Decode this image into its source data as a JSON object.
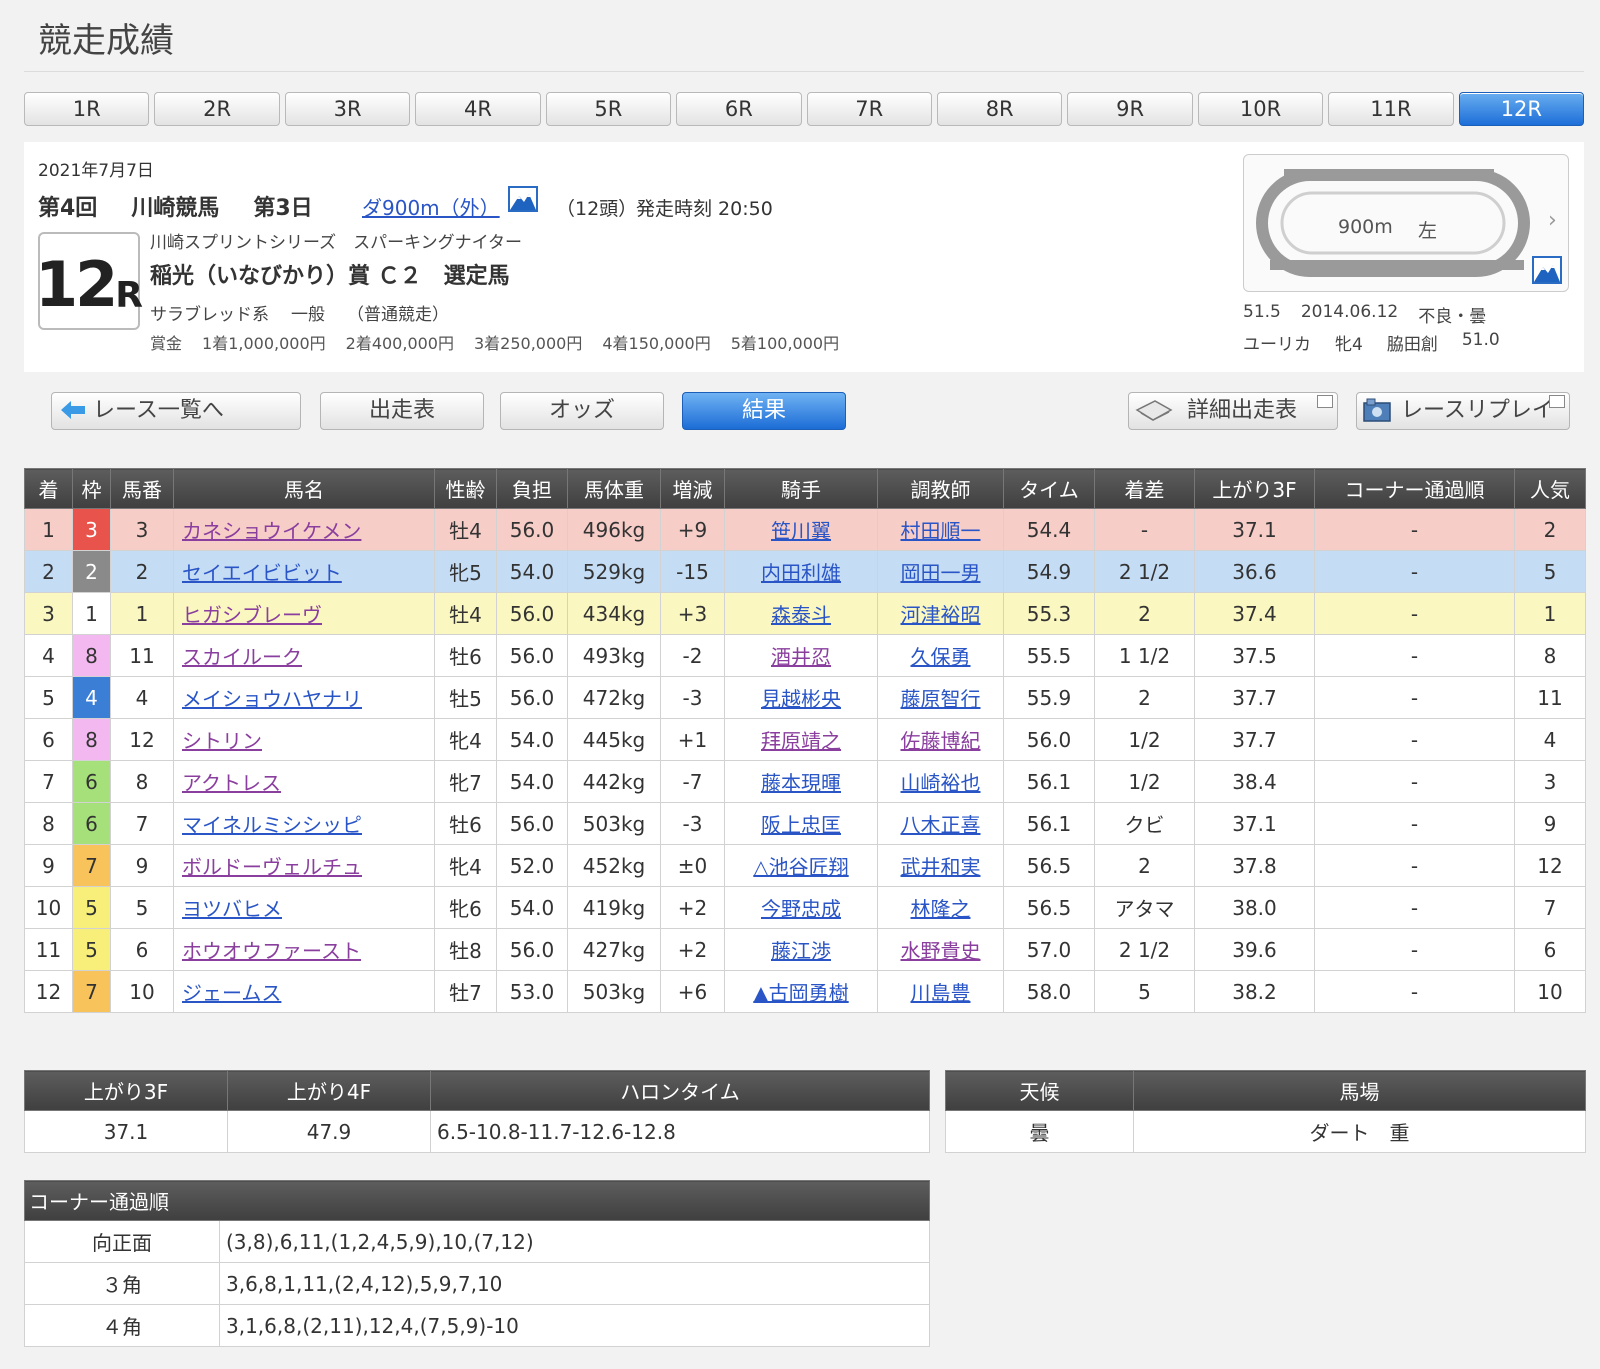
{
  "page": {
    "title": "競走成績"
  },
  "race_tabs": [
    "1R",
    "2R",
    "3R",
    "4R",
    "5R",
    "6R",
    "7R",
    "8R",
    "9R",
    "10R",
    "11R",
    "12R"
  ],
  "active_tab": "12R",
  "race_info": {
    "date": "2021年7月7日",
    "meeting": "第4回",
    "venue": "川崎競馬",
    "day": "第3日",
    "distance": "ダ900m（外）",
    "heads": "（12頭）",
    "post_time": "発走時刻 20:50",
    "race_number": "12",
    "race_number_suffix": "R",
    "series": "川崎スプリントシリーズ　スパーキングナイター",
    "race_name": "稲光（いなびかり）賞 Ｃ２　選定馬",
    "breed": "サラブレッド系",
    "class": "一般",
    "race_type": "（普通競走）",
    "prize_label": "賞金",
    "prizes": [
      "1着1,000,000円",
      "2着400,000円",
      "3着250,000円",
      "4着150,000円",
      "5着100,000円"
    ]
  },
  "course": {
    "distance": "900m",
    "direction": "左",
    "chevron": "›",
    "record_time": "51.5",
    "record_date": "2014.06.12",
    "record_condition": "不良・曇",
    "record_horse": "ユーリカ",
    "record_sex_age": "牝4",
    "record_jockey": "脇田創",
    "record_weight": "51.0"
  },
  "nav": {
    "race_list": "レース一覧へ",
    "entries": "出走表",
    "odds": "オッズ",
    "result": "結果",
    "detail_entries": "詳細出走表",
    "replay": "レースリプレイ"
  },
  "results": {
    "headers": [
      "着",
      "枠",
      "馬番",
      "馬名",
      "性齢",
      "負担",
      "馬体重",
      "増減",
      "騎手",
      "調教師",
      "タイム",
      "着差",
      "上がり3F",
      "コーナー通過順",
      "人気"
    ],
    "rows": [
      {
        "place": "1",
        "waku": "3",
        "num": "3",
        "horse": "カネショウイケメン",
        "horse_link": "purple",
        "sexage": "牡4",
        "burden": "56.0",
        "weight": "496kg",
        "diff": "+9",
        "jockey": "笹川翼",
        "jockey_link": "blue",
        "trainer": "村田順一",
        "trainer_link": "blue",
        "time": "54.4",
        "margin": "-",
        "last3f": "37.1",
        "corner": "-",
        "pop": "2"
      },
      {
        "place": "2",
        "waku": "2",
        "num": "2",
        "horse": "セイエイビビット",
        "horse_link": "blue",
        "sexage": "牝5",
        "burden": "54.0",
        "weight": "529kg",
        "diff": "-15",
        "jockey": "内田利雄",
        "jockey_link": "blue",
        "trainer": "岡田一男",
        "trainer_link": "blue",
        "time": "54.9",
        "margin": "2 1/2",
        "last3f": "36.6",
        "corner": "-",
        "pop": "5"
      },
      {
        "place": "3",
        "waku": "1",
        "num": "1",
        "horse": "ヒガシブレーヴ",
        "horse_link": "purple",
        "sexage": "牡4",
        "burden": "56.0",
        "weight": "434kg",
        "diff": "+3",
        "jockey": "森泰斗",
        "jockey_link": "blue",
        "trainer": "河津裕昭",
        "trainer_link": "blue",
        "time": "55.3",
        "margin": "2",
        "last3f": "37.4",
        "corner": "-",
        "pop": "1"
      },
      {
        "place": "4",
        "waku": "8",
        "num": "11",
        "horse": "スカイルーク",
        "horse_link": "purple",
        "sexage": "牡6",
        "burden": "56.0",
        "weight": "493kg",
        "diff": "-2",
        "jockey": "酒井忍",
        "jockey_link": "purple",
        "trainer": "久保勇",
        "trainer_link": "blue",
        "time": "55.5",
        "margin": "1 1/2",
        "last3f": "37.5",
        "corner": "-",
        "pop": "8"
      },
      {
        "place": "5",
        "waku": "4",
        "num": "4",
        "horse": "メイショウハヤナリ",
        "horse_link": "blue",
        "sexage": "牡5",
        "burden": "56.0",
        "weight": "472kg",
        "diff": "-3",
        "jockey": "見越彬央",
        "jockey_link": "blue",
        "trainer": "藤原智行",
        "trainer_link": "blue",
        "time": "55.9",
        "margin": "2",
        "last3f": "37.7",
        "corner": "-",
        "pop": "11"
      },
      {
        "place": "6",
        "waku": "8",
        "num": "12",
        "horse": "シトリン",
        "horse_link": "purple",
        "sexage": "牝4",
        "burden": "54.0",
        "weight": "445kg",
        "diff": "+1",
        "jockey": "拜原靖之",
        "jockey_link": "purple",
        "trainer": "佐藤博紀",
        "trainer_link": "purple",
        "time": "56.0",
        "margin": "1/2",
        "last3f": "37.7",
        "corner": "-",
        "pop": "4"
      },
      {
        "place": "7",
        "waku": "6",
        "num": "8",
        "horse": "アクトレス",
        "horse_link": "purple",
        "sexage": "牝7",
        "burden": "54.0",
        "weight": "442kg",
        "diff": "-7",
        "jockey": "藤本現暉",
        "jockey_link": "blue",
        "trainer": "山崎裕也",
        "trainer_link": "blue",
        "time": "56.1",
        "margin": "1/2",
        "last3f": "38.4",
        "corner": "-",
        "pop": "3"
      },
      {
        "place": "8",
        "waku": "6",
        "num": "7",
        "horse": "マイネルミシシッピ",
        "horse_link": "blue",
        "sexage": "牡6",
        "burden": "56.0",
        "weight": "503kg",
        "diff": "-3",
        "jockey": "阪上忠匡",
        "jockey_link": "blue",
        "trainer": "八木正喜",
        "trainer_link": "blue",
        "time": "56.1",
        "margin": "クビ",
        "last3f": "37.1",
        "corner": "-",
        "pop": "9"
      },
      {
        "place": "9",
        "waku": "7",
        "num": "9",
        "horse": "ボルドーヴェルチュ",
        "horse_link": "purple",
        "sexage": "牝4",
        "burden": "52.0",
        "weight": "452kg",
        "diff": "±0",
        "jockey": "△池谷匠翔",
        "jockey_link": "blue",
        "trainer": "武井和実",
        "trainer_link": "blue",
        "time": "56.5",
        "margin": "2",
        "last3f": "37.8",
        "corner": "-",
        "pop": "12"
      },
      {
        "place": "10",
        "waku": "5",
        "num": "5",
        "horse": "ヨツバヒメ",
        "horse_link": "blue",
        "sexage": "牝6",
        "burden": "54.0",
        "weight": "419kg",
        "diff": "+2",
        "jockey": "今野忠成",
        "jockey_link": "blue",
        "trainer": "林隆之",
        "trainer_link": "blue",
        "time": "56.5",
        "margin": "アタマ",
        "last3f": "38.0",
        "corner": "-",
        "pop": "7"
      },
      {
        "place": "11",
        "waku": "5",
        "num": "6",
        "horse": "ホウオウファースト",
        "horse_link": "purple",
        "sexage": "牡8",
        "burden": "56.0",
        "weight": "427kg",
        "diff": "+2",
        "jockey": "藤江渉",
        "jockey_link": "blue",
        "trainer": "水野貴史",
        "trainer_link": "purple",
        "time": "57.0",
        "margin": "2 1/2",
        "last3f": "39.6",
        "corner": "-",
        "pop": "6"
      },
      {
        "place": "12",
        "waku": "7",
        "num": "10",
        "horse": "ジェームス",
        "horse_link": "blue",
        "sexage": "牡7",
        "burden": "53.0",
        "weight": "503kg",
        "diff": "+6",
        "jockey": "▲古岡勇樹",
        "jockey_link": "blue",
        "trainer": "川島豊",
        "trainer_link": "blue",
        "time": "58.0",
        "margin": "5",
        "last3f": "38.2",
        "corner": "-",
        "pop": "10"
      }
    ]
  },
  "waku_colors": {
    "1": {
      "bg": "#ffffff",
      "fg": "#333333"
    },
    "2": {
      "bg": "#8a8a8a",
      "fg": "#ffffff"
    },
    "3": {
      "bg": "#e8534b",
      "fg": "#ffffff"
    },
    "4": {
      "bg": "#3a7ed6",
      "fg": "#ffffff"
    },
    "5": {
      "bg": "#f7ef7a",
      "fg": "#333333"
    },
    "6": {
      "bg": "#a6e07a",
      "fg": "#333333"
    },
    "7": {
      "bg": "#f7c35a",
      "fg": "#333333"
    },
    "8": {
      "bg": "#f3b8ef",
      "fg": "#333333"
    }
  },
  "laps": {
    "headers": [
      "上がり3F",
      "上がり4F",
      "ハロンタイム"
    ],
    "last3f": "37.1",
    "last4f": "47.9",
    "furlong": "6.5-10.8-11.7-12.6-12.8"
  },
  "conditions": {
    "headers": [
      "天候",
      "馬場"
    ],
    "weather": "曇",
    "track": "ダート　重"
  },
  "corners": {
    "title": "コーナー通過順",
    "rows": [
      {
        "label": "向正面",
        "order": "(3,8),6,11,(1,2,4,5,9),10,(7,12)"
      },
      {
        "label": "３角",
        "order": "3,6,8,1,11,(2,4,12),5,9,7,10"
      },
      {
        "label": "４角",
        "order": "3,1,6,8,(2,11),12,4,(7,5,9)-10"
      }
    ]
  }
}
